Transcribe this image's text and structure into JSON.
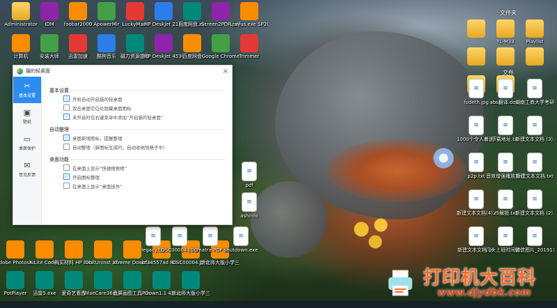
{
  "desktop": {
    "left_icons": [
      {
        "label": "Administrator",
        "kind": "folder"
      },
      {
        "label": "IDM",
        "kind": "app"
      },
      {
        "label": "foobar2000",
        "kind": "app"
      },
      {
        "label": "ApowerMir",
        "kind": "app"
      },
      {
        "label": "LuckyMark",
        "kind": "app"
      },
      {
        "label": "HP DeskJet 2130 series",
        "kind": "app"
      },
      {
        "label": "百度网盘.zip",
        "kind": "app"
      },
      {
        "label": "Screen2PDF-pdf",
        "kind": "app"
      },
      {
        "label": "Lrayus.exe SP2004",
        "kind": "app"
      },
      {
        "label": "计算机",
        "kind": "app"
      },
      {
        "label": "安装大师",
        "kind": "app"
      },
      {
        "label": "迅雷加速",
        "kind": "app"
      },
      {
        "label": "酷狗音乐",
        "kind": "app"
      },
      {
        "label": "磁力资源提取",
        "kind": "app"
      },
      {
        "label": "HP DeskJet 4530 series",
        "kind": "app"
      },
      {
        "label": "百度网盘",
        "kind": "app"
      },
      {
        "label": "Google Chrome",
        "kind": "app"
      },
      {
        "label": "Trimmer",
        "kind": "app"
      }
    ],
    "right_top_title": "文件夹",
    "right_folders": [
      "",
      "TL-M33",
      "Playlist",
      "",
      "",
      "",
      "",
      ""
    ],
    "right_mid_title": "文件",
    "right_files": [
      {
        "label": "fudeth.jpg"
      },
      {
        "label": "abs翻译.docx"
      },
      {
        "label": "湖南工商大学考研..."
      },
      {
        "label": "1000个令人着迷的..."
      },
      {
        "label": "下载地址.txt"
      },
      {
        "label": "新建文本文档 (3).txt"
      },
      {
        "label": "p2p.txt"
      },
      {
        "label": "音效增强播放插件FxS..."
      },
      {
        "label": "新建文本文档.txt"
      },
      {
        "label": "新建文本文档(4).txt"
      },
      {
        "label": "z5解锁.txt"
      },
      {
        "label": "新建文本文档 (2).txt"
      },
      {
        "label": "新建文本文档.txt"
      },
      {
        "label": "门头上班时间统计.xlsx"
      },
      {
        "label": "微信图片_2019110..."
      }
    ],
    "bottom_icons": [
      {
        "label": "Adobe Photoshop..."
      },
      {
        "label": "K-Lite Codec"
      },
      {
        "label": "购买材料 HP Deskje..."
      },
      {
        "label": "IObitUninst allerPorta..."
      },
      {
        "label": "Xtreme Download..."
      },
      {
        "label": "bf34557ad 8d81372c..."
      },
      {
        "label": "DSC00004.J PG"
      },
      {
        "label": "新北师大版小学三年..."
      },
      {
        "label": "PotPlayer"
      },
      {
        "label": "迅雷5.exe"
      },
      {
        "label": "爱奇艺看图"
      },
      {
        "label": "WiseCare36 5.exe"
      },
      {
        "label": "截屏画图工具.xlsx"
      },
      {
        "label": "PDown1.1 4.4.exe"
      },
      {
        "label": "新北师大版小学三年级..."
      }
    ],
    "mid_icons": [
      {
        "label": "legacy.txt"
      },
      {
        "label": "DSC00004.J PG"
      },
      {
        "label": "Sumatra PDF settings.txt"
      },
      {
        "label": "shutdown.exe"
      },
      {
        "label": "pdf"
      },
      {
        "label": "ashinfo"
      }
    ]
  },
  "window": {
    "title": "猫的轻桌面",
    "close": "×",
    "nav": [
      {
        "label": "基本设置",
        "icon": "✂",
        "active": true
      },
      {
        "label": "壁纸",
        "icon": "▣",
        "active": false
      },
      {
        "label": "桌面保护",
        "icon": "▭",
        "active": false
      },
      {
        "label": "意见反馈",
        "icon": "✉",
        "active": false
      }
    ],
    "groups": [
      {
        "title": "基本设置",
        "options": [
          {
            "label": "开机自动开启猫的轻桌面",
            "checked": true
          },
          {
            "label": "双击桌面空白处隐藏桌面图标",
            "checked": false
          },
          {
            "label": "未开启时在右键菜单中添加“开启猫的轻桌面”",
            "checked": true
          }
        ]
      },
      {
        "title": "自动整理",
        "options": [
          {
            "label": "桌面新增图标，提醒整理",
            "checked": true
          },
          {
            "label": "自动整理（新图标生成时，自动收纳到格子中）",
            "checked": false
          }
        ]
      },
      {
        "title": "桌面功能",
        "options": [
          {
            "label": "在桌面上显示“快捷搜索框”",
            "checked": false
          },
          {
            "label": "开启图标整理",
            "checked": true
          },
          {
            "label": "在桌面上显示“桌面挂件”",
            "checked": false
          }
        ]
      }
    ]
  },
  "watermark": {
    "line1": "打印机大百科",
    "line2": "www.djydbk.com"
  },
  "colors": {
    "accent": "#2c8cf0",
    "watermark": "#ff6a2a"
  }
}
